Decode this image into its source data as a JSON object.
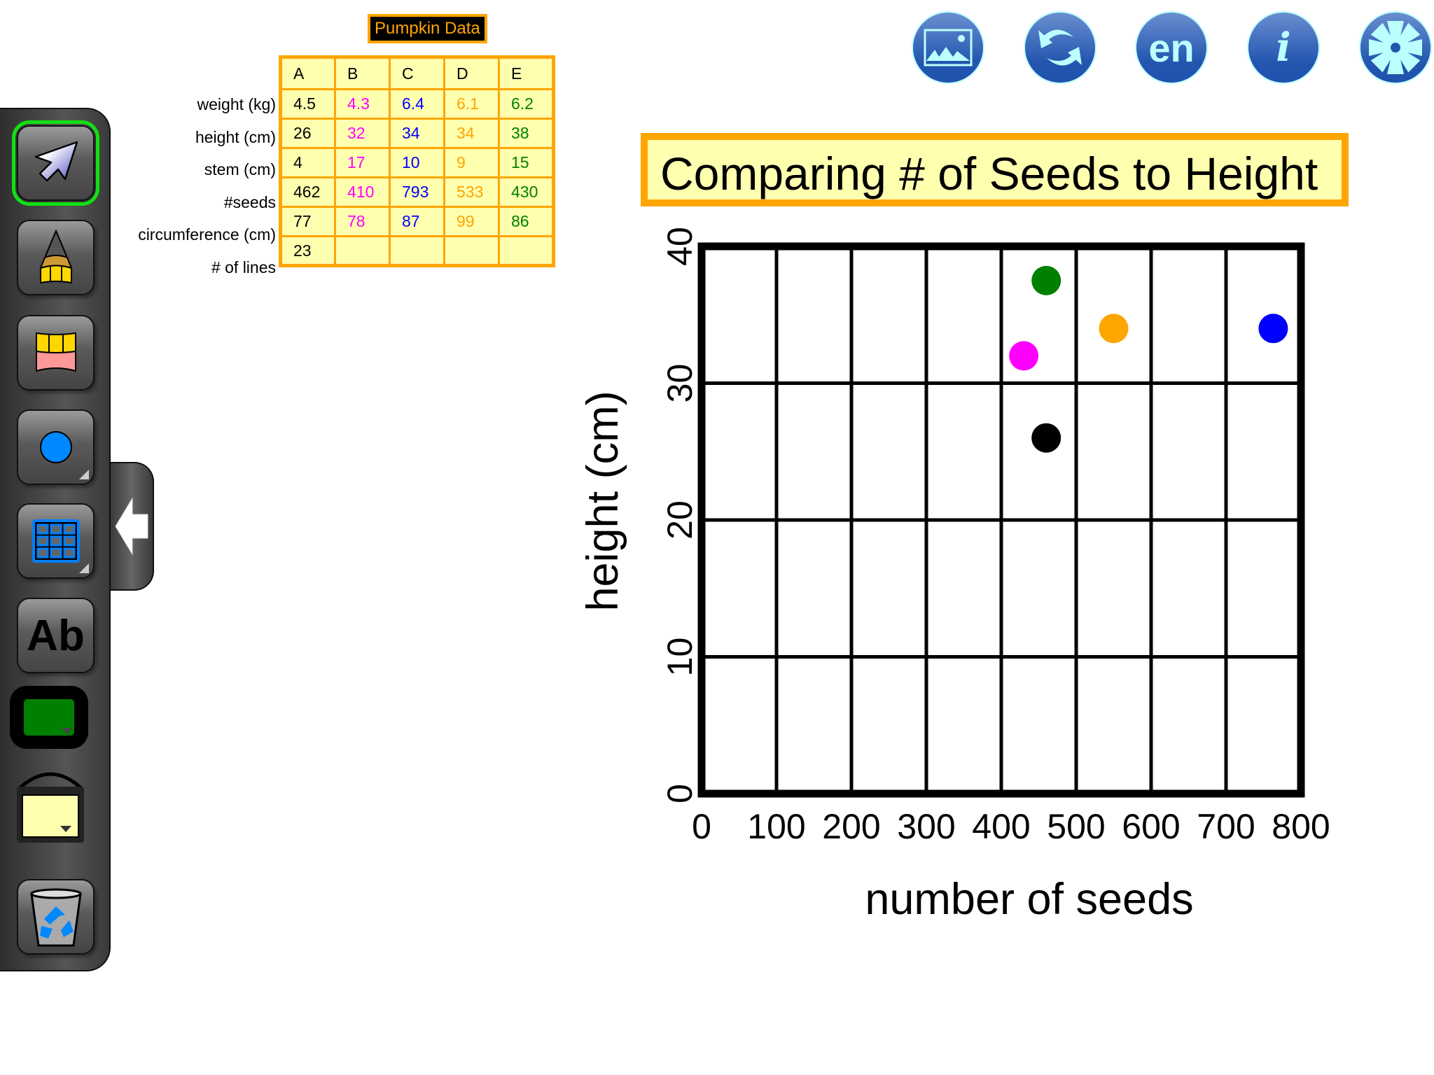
{
  "toolbar": {
    "tools": [
      {
        "name": "select-tool",
        "icon": "arrow-pointer-icon",
        "selected": true
      },
      {
        "name": "pencil-tool",
        "icon": "pencil-icon"
      },
      {
        "name": "eraser-tool",
        "icon": "eraser-icon"
      },
      {
        "name": "shape-tool",
        "icon": "circle-icon"
      },
      {
        "name": "table-tool",
        "icon": "grid-icon"
      },
      {
        "name": "text-tool",
        "icon": "text-icon",
        "label": "Ab"
      },
      {
        "name": "pen-color",
        "icon": "color-swatch-icon",
        "color": "#008000"
      },
      {
        "name": "fill-color",
        "icon": "paint-bucket-icon",
        "color": "#ffffb0"
      },
      {
        "name": "trash",
        "icon": "recycle-bin-icon"
      }
    ],
    "collapse_tab_icon": "arrow-left-icon"
  },
  "top_icons": [
    {
      "name": "background-image",
      "icon": "image-icon"
    },
    {
      "name": "reset",
      "icon": "refresh-icon"
    },
    {
      "name": "language",
      "icon": "language-icon",
      "label": "en"
    },
    {
      "name": "info",
      "icon": "info-icon",
      "label": "i"
    },
    {
      "name": "settings",
      "icon": "gear-icon"
    }
  ],
  "pumpkin_table": {
    "title": "Pumpkin Data",
    "columns": [
      "A",
      "B",
      "C",
      "D",
      "E"
    ],
    "column_colors": [
      "#000000",
      "#ff00ff",
      "#0000ff",
      "#ffa500",
      "#008000"
    ],
    "rows": [
      {
        "label": "weight (kg)",
        "values": [
          "4.5",
          "4.3",
          "6.4",
          "6.1",
          "6.2"
        ]
      },
      {
        "label": "height (cm)",
        "values": [
          "26",
          "32",
          "34",
          "34",
          "38"
        ]
      },
      {
        "label": "stem (cm)",
        "values": [
          "4",
          "17",
          "10",
          "9",
          "15"
        ]
      },
      {
        "label": "#seeds",
        "values": [
          "462",
          "410",
          "793",
          "533",
          "430"
        ]
      },
      {
        "label": "circumference (cm)",
        "values": [
          "77",
          "78",
          "87",
          "99",
          "86"
        ]
      },
      {
        "label": "# of lines",
        "values": [
          "23",
          "",
          "",
          "",
          ""
        ]
      }
    ]
  },
  "chart_data": {
    "type": "scatter",
    "title": "Comparing # of Seeds to Height",
    "xlabel": "number of seeds",
    "ylabel": "height (cm)",
    "xlim": [
      0,
      800
    ],
    "ylim": [
      0,
      40
    ],
    "xticks": [
      "0",
      "100",
      "200",
      "300",
      "400",
      "500",
      "600",
      "700",
      "800"
    ],
    "yticks": [
      "0",
      "10",
      "20",
      "30",
      "40"
    ],
    "grid": true,
    "points": [
      {
        "x": 460,
        "y": 26,
        "color": "#000000"
      },
      {
        "x": 430,
        "y": 32,
        "color": "#ff00ff"
      },
      {
        "x": 460,
        "y": 37.5,
        "color": "#008000"
      },
      {
        "x": 550,
        "y": 34,
        "color": "#ffa500"
      },
      {
        "x": 763,
        "y": 34,
        "color": "#0000ff"
      }
    ]
  }
}
